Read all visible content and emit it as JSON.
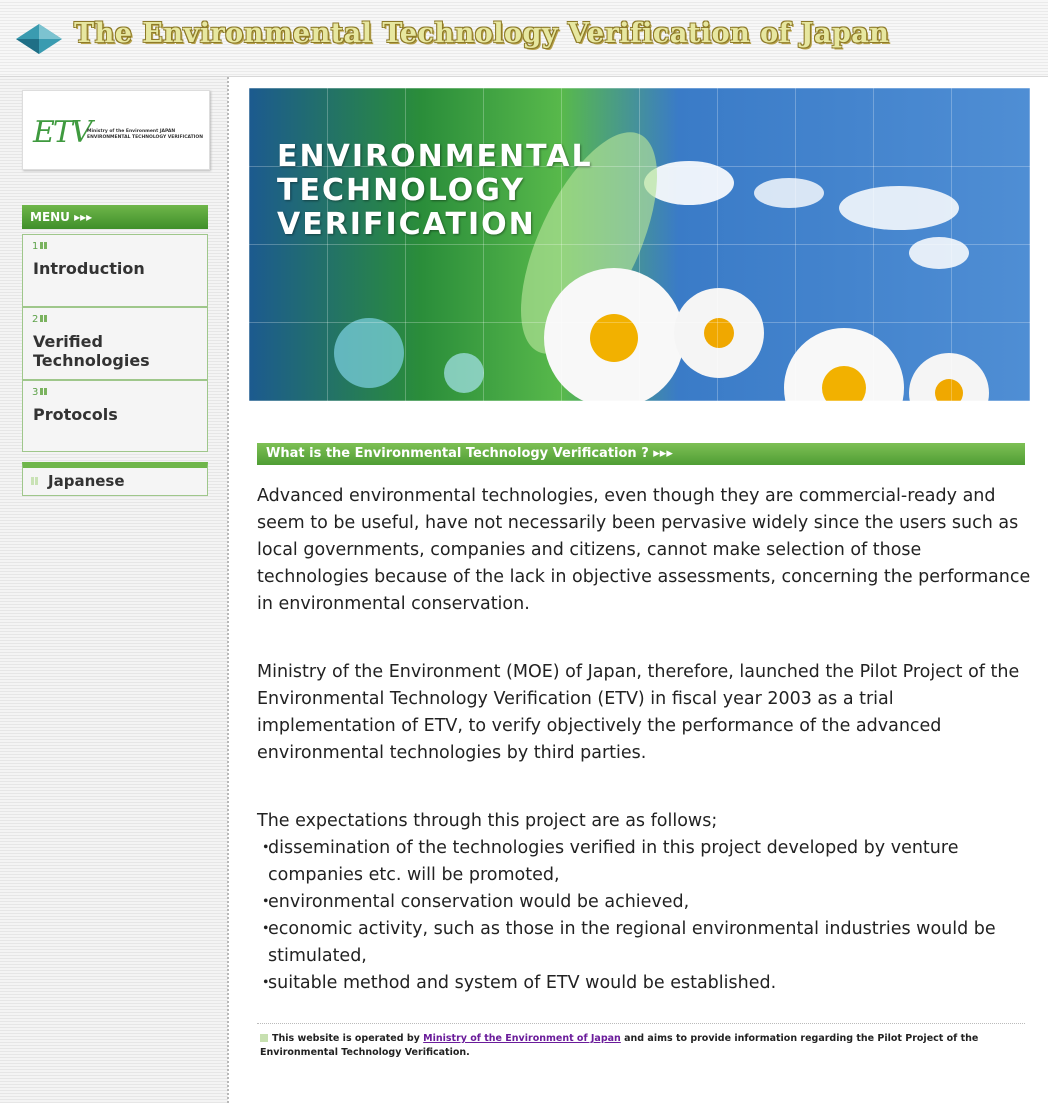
{
  "header": {
    "title": "The Environmental Technology Verification of Japan"
  },
  "colors": {
    "accent_green": "#5ea83d",
    "link": "#6a1b9a",
    "title_gold": "#e7e7a0"
  },
  "logo": {
    "mark": "ETV",
    "small_text": "Ministry of the Environment JAPAN ENVIRONMENTAL TECHNOLOGY VERIFICATION"
  },
  "menu": {
    "heading": "MENU ▸▸▸",
    "items": [
      {
        "num": "1",
        "label": "Introduction"
      },
      {
        "num": "2",
        "label": "Verified Technologies"
      },
      {
        "num": "3",
        "label": "Protocols"
      }
    ],
    "japanese": "Japanese"
  },
  "banner": {
    "line1": "ENVIRONMENTAL",
    "line2": "TECHNOLOGY",
    "line3": "VERIFICATION"
  },
  "section": {
    "heading": "What is the Environmental Technology Verification ? ▸▸▸"
  },
  "body": {
    "p1": "Advanced environmental technologies, even though they are commercial-ready and seem to be useful, have not necessarily been pervasive widely since the users such as local governments, companies and citizens, cannot make selection of those technologies because of the lack in objective assessments, concerning the performance in environmental conservation.",
    "p2": "Ministry of the Environment (MOE) of Japan, therefore, launched the Pilot Project of the Environmental Technology Verification (ETV) in fiscal year 2003 as a trial implementation of ETV, to verify objectively the performance of the advanced environmental technologies by third parties.",
    "p3": "The expectations through this project are as follows;",
    "bullets": [
      "dissemination of the technologies verified in this project developed by venture companies etc. will be promoted,",
      "environmental conservation would be achieved,",
      "economic activity, such as those in the regional environmental industries would be stimulated,",
      "suitable method and system of ETV would be established."
    ]
  },
  "footer": {
    "prefix": "This website is operated by ",
    "link": "Ministry of the Environment of Japan",
    "suffix": " and aims to provide information regarding the Pilot Project of the Environmental Technology Verification."
  }
}
